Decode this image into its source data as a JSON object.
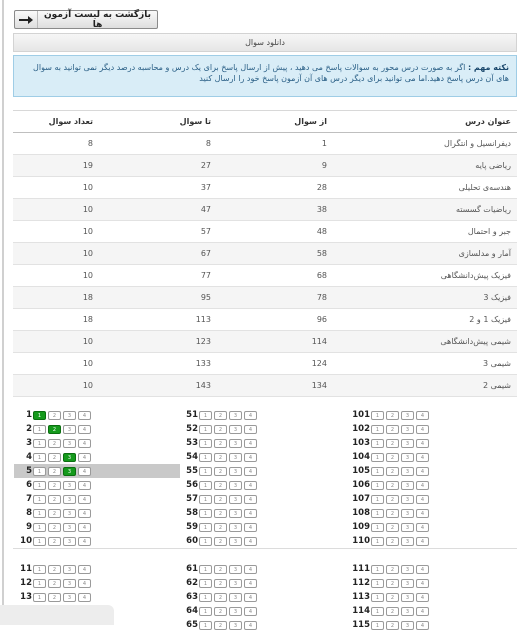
{
  "back_button": {
    "label": "بازگشت به لیست آزمون ها"
  },
  "download_label": "دانلود سوال",
  "note": {
    "title": "نکته مهم :",
    "text": "اگر به صورت درس محور به سوالات پاسخ می دهید ، پیش از ارسال پاسخ برای یک درس و محاسبه درصد دیگر نمی توانید به سوال های آن درس پاسخ دهید.اما می توانید برای دیگر درس های آن آزمون پاسخ خود را ارسال کنید"
  },
  "table": {
    "headers": {
      "course": "عنوان درس",
      "from": "از سوال",
      "to": "تا سوال",
      "count": "تعداد سوال"
    },
    "rows": [
      {
        "course": "دیفرانسیل و انتگرال",
        "from": "1",
        "to": "8",
        "count": "8"
      },
      {
        "course": "ریاضی پایه",
        "from": "9",
        "to": "27",
        "count": "19"
      },
      {
        "course": "هندسه‌ی تحلیلی",
        "from": "28",
        "to": "37",
        "count": "10"
      },
      {
        "course": "ریاضیات گسسته",
        "from": "38",
        "to": "47",
        "count": "10"
      },
      {
        "course": "جبر و احتمال",
        "from": "48",
        "to": "57",
        "count": "10"
      },
      {
        "course": "آمار و مدلسازی",
        "from": "58",
        "to": "67",
        "count": "10"
      },
      {
        "course": "فیزیک پیش‌دانشگاهی",
        "from": "68",
        "to": "77",
        "count": "10"
      },
      {
        "course": "فیزیک 3",
        "from": "78",
        "to": "95",
        "count": "18"
      },
      {
        "course": "فیزیک 1 و 2",
        "from": "96",
        "to": "113",
        "count": "18"
      },
      {
        "course": "شیمی پیش‌دانشگاهی",
        "from": "114",
        "to": "123",
        "count": "10"
      },
      {
        "course": "شیمی 3",
        "from": "124",
        "to": "133",
        "count": "10"
      },
      {
        "course": "شیمی 2",
        "from": "134",
        "to": "143",
        "count": "10"
      }
    ]
  },
  "option_labels": [
    "1",
    "2",
    "3",
    "4"
  ],
  "answer_columns": [
    {
      "questions": [
        1,
        2,
        3,
        4,
        5,
        6,
        7,
        8,
        9,
        10
      ],
      "rest": [
        11,
        12,
        13
      ]
    },
    {
      "questions": [
        51,
        52,
        53,
        54,
        55,
        56,
        57,
        58,
        59,
        60
      ],
      "rest": [
        61,
        62,
        63,
        64,
        65
      ]
    },
    {
      "questions": [
        101,
        102,
        103,
        104,
        105,
        106,
        107,
        108,
        109,
        110
      ],
      "rest": [
        111,
        112,
        113,
        114,
        115
      ]
    }
  ],
  "selected_answers": {
    "1": 1,
    "2": 2,
    "4": 3,
    "5": 3
  },
  "highlighted_question": 5
}
